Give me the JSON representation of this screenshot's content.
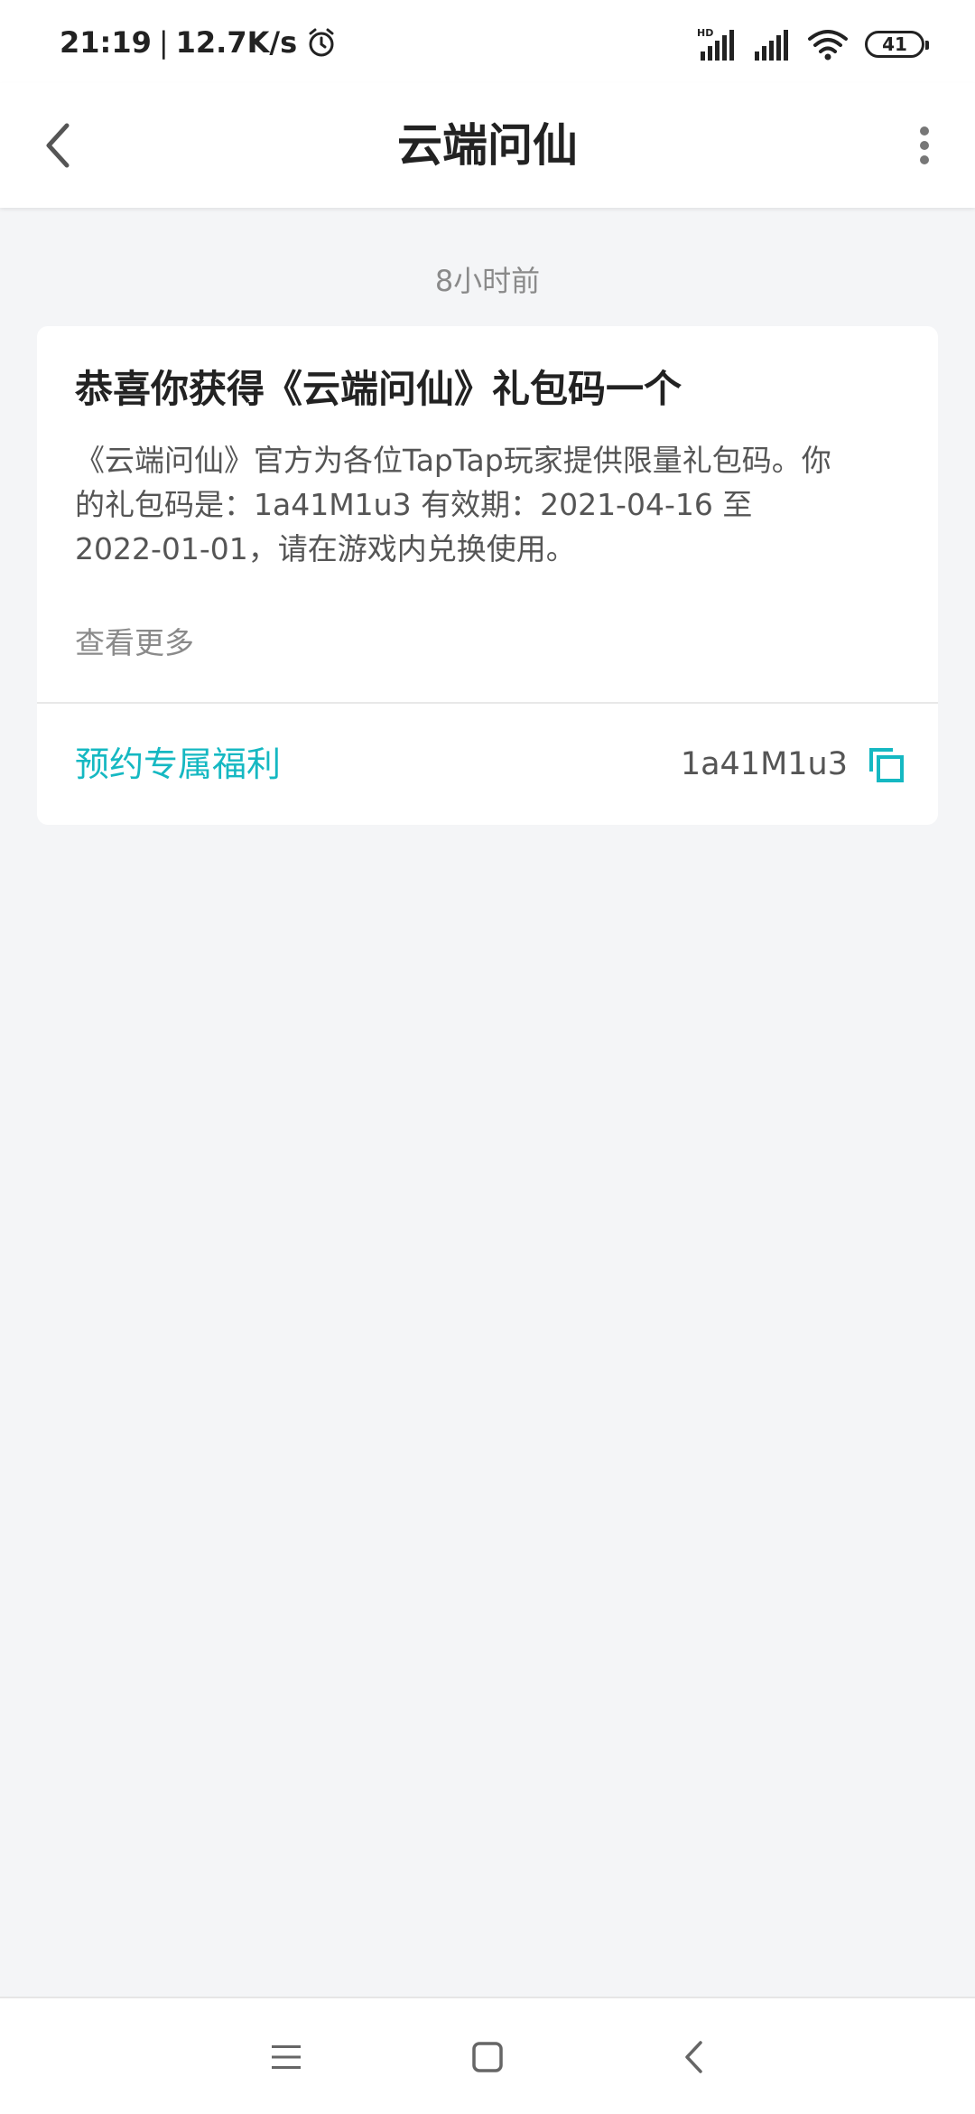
{
  "status_bar": {
    "time": "21:19",
    "separator": "|",
    "network_speed": "12.7K/s",
    "battery_level": "41",
    "icons": [
      "alarm-icon",
      "hd-signal-icon",
      "signal-icon",
      "wifi-icon",
      "battery-icon"
    ]
  },
  "header": {
    "title": "云端问仙",
    "back_icon": "chevron-left-icon",
    "more_icon": "more-vertical-icon"
  },
  "message": {
    "timestamp": "8小时前",
    "title": "恭喜你获得《云端问仙》礼包码一个",
    "body_lines": [
      "《云端问仙》官方为各位TapTap玩家提供限量礼包码。你",
      "的礼包码是：1a41M1u3 有效期：2021-04-16 至",
      "2022-01-01，请在游戏内兑换使用。"
    ],
    "view_more": "查看更多",
    "action_label": "预约专属福利",
    "gift_code": "1a41M1u3",
    "copy_icon": "copy-icon"
  },
  "nav_bar": {
    "items": [
      "menu-icon",
      "home-square-icon",
      "back-chevron-icon"
    ]
  },
  "colors": {
    "accent": "#15b8c2",
    "background": "#f4f5f7",
    "card": "#ffffff"
  }
}
